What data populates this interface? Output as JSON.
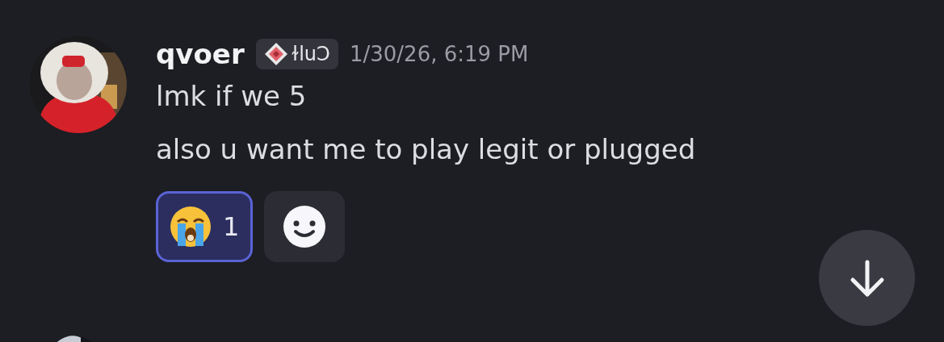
{
  "message": {
    "author": "qvoer",
    "tag": "ɫluϽ",
    "timestamp": "1/30/26, 6:19 PM",
    "lines": [
      "lmk if we 5",
      "also u want me to play legit or plugged"
    ],
    "reactions": [
      {
        "kind": "emoji",
        "count": "1",
        "selected": true
      },
      {
        "kind": "add"
      }
    ]
  }
}
